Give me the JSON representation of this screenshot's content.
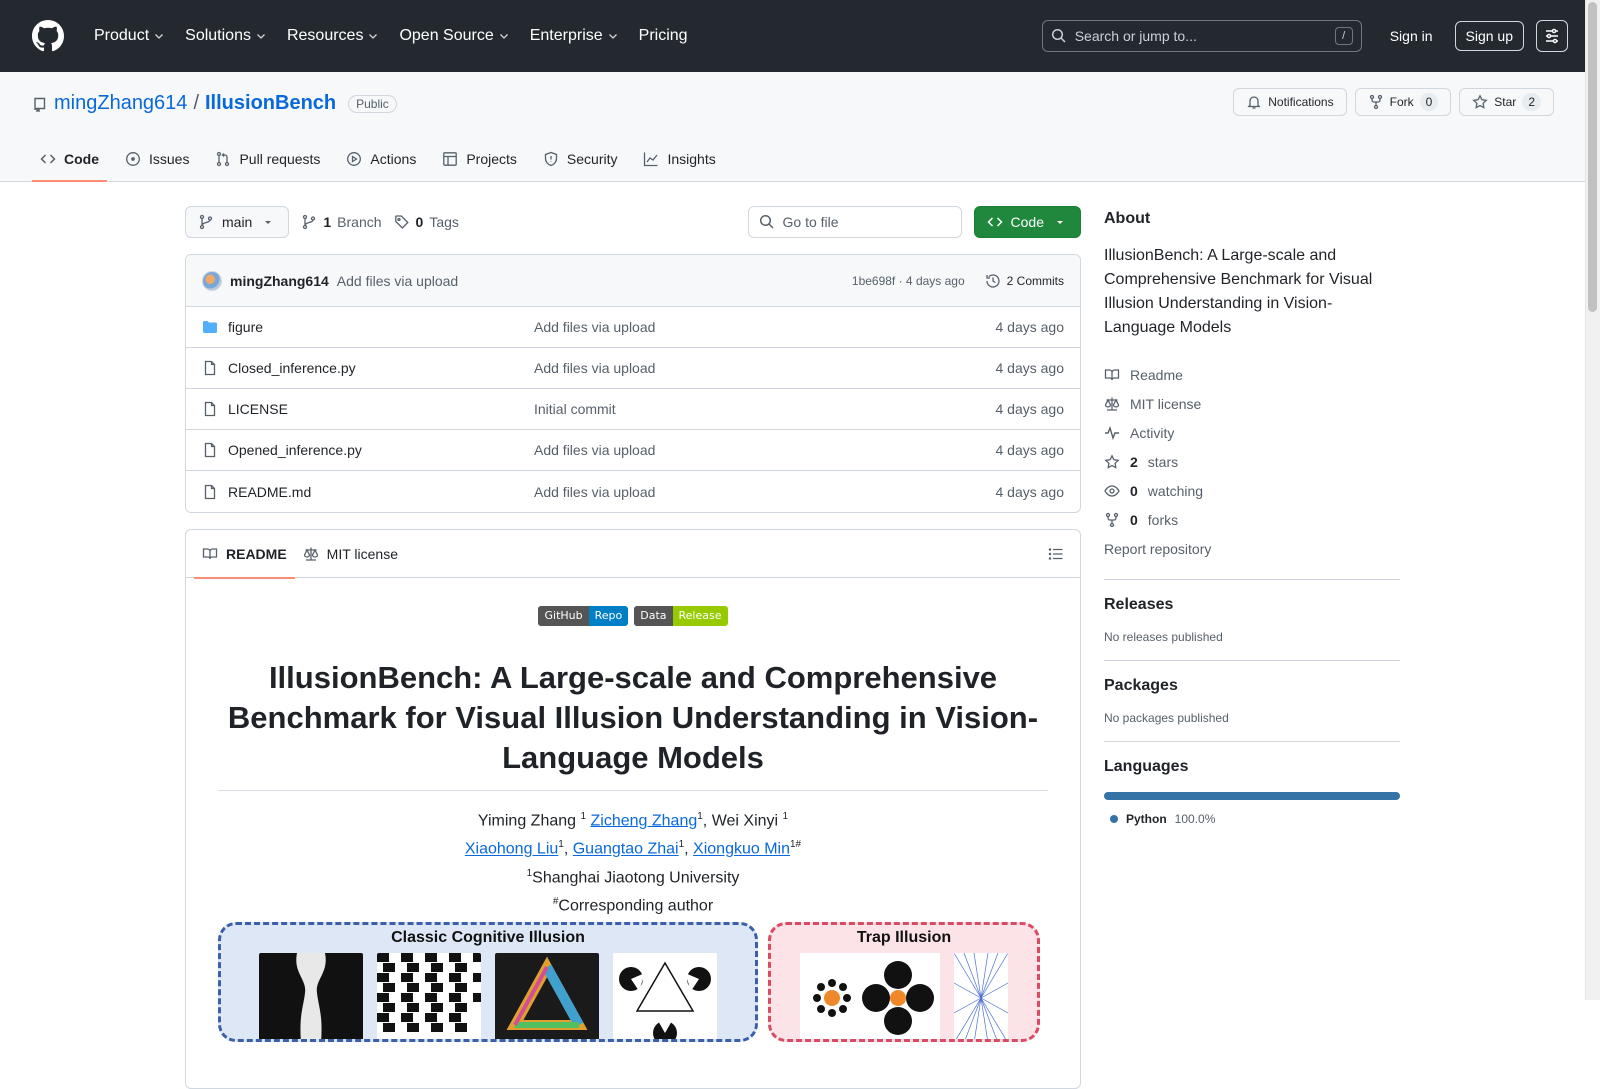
{
  "header": {
    "nav": [
      "Product",
      "Solutions",
      "Resources",
      "Open Source",
      "Enterprise",
      "Pricing"
    ],
    "search_placeholder": "Search or jump to...",
    "slash": "/",
    "sign_in": "Sign in",
    "sign_up": "Sign up"
  },
  "repo": {
    "owner": "mingZhang614",
    "slash": "/",
    "name": "IllusionBench",
    "visibility": "Public",
    "notifications": "Notifications",
    "fork_label": "Fork",
    "fork_count": "0",
    "star_label": "Star",
    "star_count": "2",
    "tabs": [
      "Code",
      "Issues",
      "Pull requests",
      "Actions",
      "Projects",
      "Security",
      "Insights"
    ]
  },
  "toolbar": {
    "branch": "main",
    "branch_count": "1",
    "branch_label": "Branch",
    "tag_count": "0",
    "tag_label": "Tags",
    "goto_placeholder": "Go to file",
    "code_button": "Code"
  },
  "latest_commit": {
    "author": "mingZhang614",
    "message": "Add files via upload",
    "hash_time": "1be698f · 4 days ago",
    "commits": "2 Commits"
  },
  "files": [
    {
      "name": "figure",
      "type": "folder",
      "commit": "Add files via upload",
      "date": "4 days ago"
    },
    {
      "name": "Closed_inference.py",
      "type": "file",
      "commit": "Add files via upload",
      "date": "4 days ago"
    },
    {
      "name": "LICENSE",
      "type": "file",
      "commit": "Initial commit",
      "date": "4 days ago"
    },
    {
      "name": "Opened_inference.py",
      "type": "file",
      "commit": "Add files via upload",
      "date": "4 days ago"
    },
    {
      "name": "README.md",
      "type": "file",
      "commit": "Add files via upload",
      "date": "4 days ago"
    }
  ],
  "readme": {
    "tab_readme": "README",
    "tab_license": "MIT license",
    "badge1_left": "GitHub",
    "badge1_right": "Repo",
    "badge2_left": "Data",
    "badge2_right": "Release",
    "title": "IllusionBench: A Large-scale and Comprehensive Benchmark for Visual Illusion Understanding in Vision-Language Models",
    "author1": "Yiming Zhang ",
    "author2": "Zicheng Zhang",
    "author3": ", Wei Xinyi ",
    "author4": "Xiaohong Liu",
    "author5": "Guangtao Zhai",
    "author6": "Xiongkuo Min",
    "sep": ", ",
    "sup1": "1",
    "sup_corr": "1#",
    "affiliation": "Shanghai Jiaotong University",
    "corr_mark": "#",
    "corr": "Corresponding author",
    "fig_classic": "Classic Cognitive Illusion",
    "fig_trap": "Trap Illusion"
  },
  "about": {
    "heading": "About",
    "description": "IllusionBench: A Large-scale and Comprehensive Benchmark for Visual Illusion Understanding in Vision-Language Models",
    "readme": "Readme",
    "license": "MIT license",
    "activity": "Activity",
    "stars_count": "2",
    "stars_label": "stars",
    "watching_count": "0",
    "watching_label": "watching",
    "forks_count": "0",
    "forks_label": "forks",
    "report": "Report repository"
  },
  "releases": {
    "heading": "Releases",
    "text": "No releases published"
  },
  "packages": {
    "heading": "Packages",
    "text": "No packages published"
  },
  "languages": {
    "heading": "Languages",
    "name": "Python",
    "percent": "100.0%",
    "color": "#3572A5"
  }
}
